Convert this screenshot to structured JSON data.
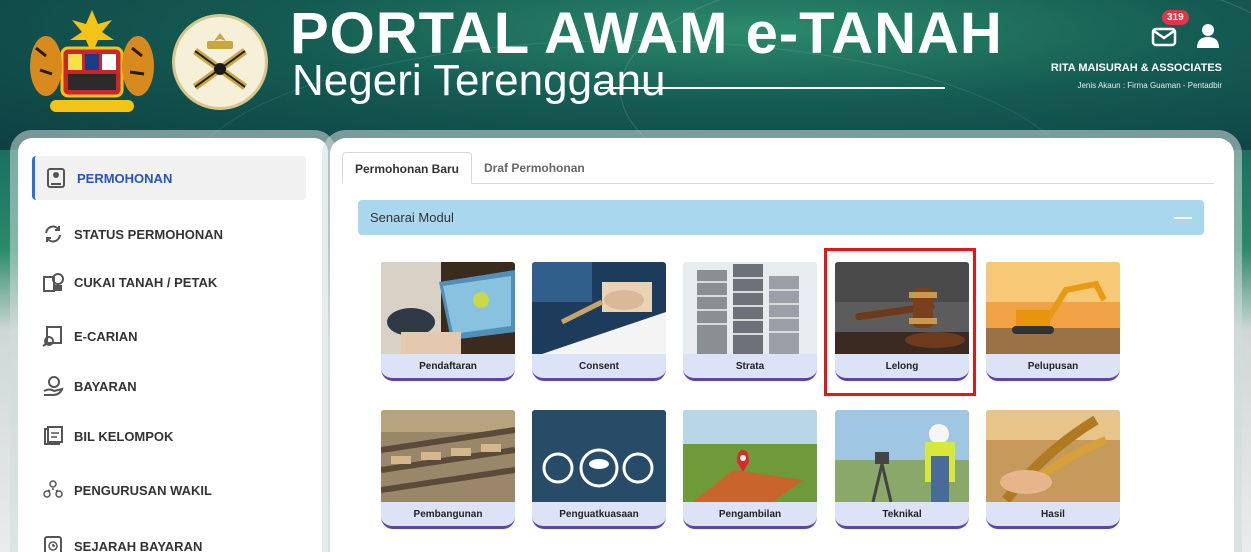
{
  "header": {
    "title": "PORTAL AWAM e-TANAH",
    "subtitle": "Negeri Terengganu",
    "badge_count": "319",
    "user_name": "RITA MAISURAH & ASSOCIATES",
    "account_type": "Jenis Akaun : Firma Guaman - Pentadbir",
    "icons": [
      "envelope-icon",
      "user-icon"
    ]
  },
  "sidebar": {
    "items": [
      {
        "label": "PERMOHONAN",
        "icon": "application-form-icon"
      },
      {
        "label": "STATUS PERMOHONAN",
        "icon": "refresh-icon"
      },
      {
        "label": "CUKAI TANAH / PETAK",
        "icon": "tax-building-icon"
      },
      {
        "label": "E-CARIAN",
        "icon": "search-document-icon"
      },
      {
        "label": "BAYARAN",
        "icon": "payment-hand-icon"
      },
      {
        "label": "BIL KELOMPOK",
        "icon": "bill-icon"
      },
      {
        "label": "PENGURUSAN WAKIL",
        "icon": "agents-icon"
      },
      {
        "label": "SEJARAH BAYARAN",
        "icon": "history-icon"
      }
    ]
  },
  "main": {
    "tabs": [
      {
        "label": "Permohonan Baru",
        "active": true
      },
      {
        "label": "Draf Permohonan",
        "active": false
      }
    ],
    "module_header": "Senarai Modul",
    "toggle": "—",
    "modules": [
      {
        "label": "Pendaftaran"
      },
      {
        "label": "Consent"
      },
      {
        "label": "Strata"
      },
      {
        "label": "Lelong"
      },
      {
        "label": "Pelupusan"
      },
      {
        "label": "Pembangunan"
      },
      {
        "label": "Penguatkuasaan"
      },
      {
        "label": "Pengambilan"
      },
      {
        "label": "Teknikal"
      },
      {
        "label": "Hasil"
      }
    ]
  },
  "colors": {
    "accent": "#2c6fe0",
    "module_bar": "#a9d7ee",
    "card_label_bg": "#dde3f6",
    "card_border": "#5b45a8",
    "highlight": "#e01818",
    "badge": "#e0344a"
  }
}
